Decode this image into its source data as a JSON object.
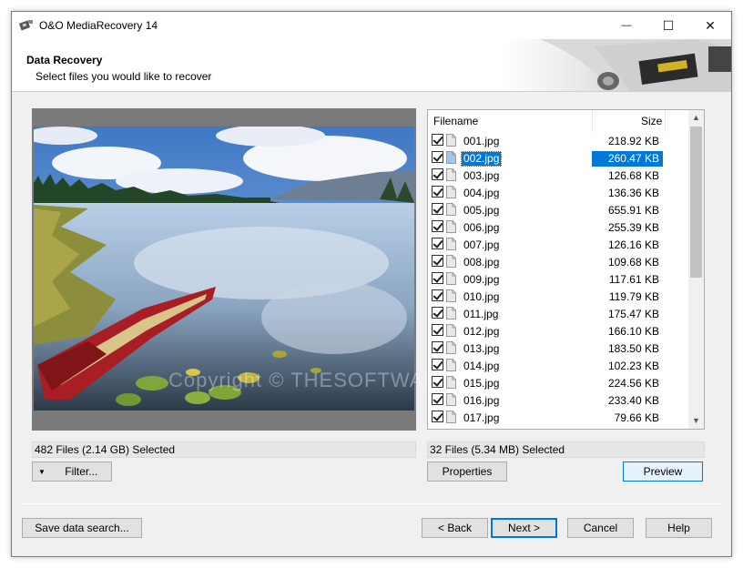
{
  "window": {
    "title": "O&O MediaRecovery 14",
    "controls": {
      "minimize": "—",
      "maximize": "☐",
      "close": "✕"
    }
  },
  "header": {
    "title": "Data Recovery",
    "subtitle": "Select files you would like to recover"
  },
  "preview": {
    "watermark": "Copyright © THESOFTWARE.SHOP"
  },
  "filelist": {
    "columns": {
      "name": "Filename",
      "size": "Size"
    },
    "rows": [
      {
        "name": "001.jpg",
        "size": "218.92 KB"
      },
      {
        "name": "002.jpg",
        "size": "260.47 KB"
      },
      {
        "name": "003.jpg",
        "size": "126.68 KB"
      },
      {
        "name": "004.jpg",
        "size": "136.36 KB"
      },
      {
        "name": "005.jpg",
        "size": "655.91 KB"
      },
      {
        "name": "006.jpg",
        "size": "255.39 KB"
      },
      {
        "name": "007.jpg",
        "size": "126.16 KB"
      },
      {
        "name": "008.jpg",
        "size": "109.68 KB"
      },
      {
        "name": "009.jpg",
        "size": "117.61 KB"
      },
      {
        "name": "010.jpg",
        "size": "119.79 KB"
      },
      {
        "name": "011.jpg",
        "size": "175.47 KB"
      },
      {
        "name": "012.jpg",
        "size": "166.10 KB"
      },
      {
        "name": "013.jpg",
        "size": "183.50 KB"
      },
      {
        "name": "014.jpg",
        "size": "102.23 KB"
      },
      {
        "name": "015.jpg",
        "size": "224.56 KB"
      },
      {
        "name": "016.jpg",
        "size": "233.40 KB"
      },
      {
        "name": "017.jpg",
        "size": "79.66 KB"
      }
    ],
    "selected_name": "002.jpg"
  },
  "status": {
    "left": "482 Files (2.14 GB) Selected",
    "right": "32 Files (5.34 MB) Selected"
  },
  "buttons": {
    "filter": "Filter...",
    "properties": "Properties",
    "preview": "Preview",
    "save_search": "Save data search...",
    "back": "< Back",
    "next": "Next >",
    "cancel": "Cancel",
    "help": "Help"
  },
  "colors": {
    "selection": "#0078d7",
    "window_bg": "#f0f0f0"
  },
  "icons": {
    "app": "recovery-app-icon",
    "file": "image-file-icon",
    "filter_arrow": "triangle-down-icon"
  }
}
